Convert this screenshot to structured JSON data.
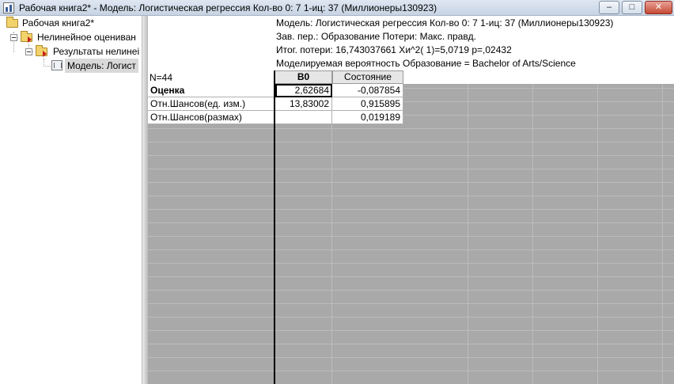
{
  "window": {
    "title": "Рабочая книга2* - Модель: Логистическая регрессия Кол-во 0: 7 1-иц: 37 (Миллионеры130923)",
    "icon": "workbook-icon",
    "controls": {
      "minimize": "–",
      "maximize": "□",
      "close": "✕"
    }
  },
  "tree": {
    "root": "Рабочая книга2*",
    "node1": "Нелинейное оцениван",
    "node2": "Результаты нелинеі",
    "node3": "Модель: Логист"
  },
  "sheet": {
    "info_lines": [
      "Модель: Логистическая регрессия Кол-во 0: 7 1-иц: 37 (Миллионеры130923)",
      "Зав. пер.: Образование Потери: Макс. правд.",
      "Итог. потери: 16,743037661 Хи^2( 1)=5,0719 p=,02432",
      "Моделируемая вероятность Образование = Bachelor of Arts/Science"
    ],
    "n_label": "N=44",
    "columns": [
      "B0",
      "Состояние"
    ],
    "rows": [
      {
        "label": "Оценка",
        "b0": "2,62684",
        "state": "-0,087854"
      },
      {
        "label": "Отн.Шансов(ед. изм.)",
        "b0": "13,83002",
        "state": "0,915895"
      },
      {
        "label": "Отн.Шансов(размах)",
        "b0": "",
        "state": "0,019189"
      }
    ]
  }
}
